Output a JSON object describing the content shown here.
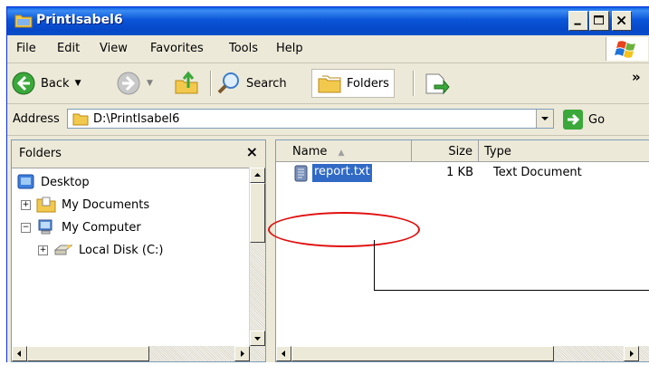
{
  "window": {
    "title": "PrintIsabel6"
  },
  "menubar": {
    "items": [
      "File",
      "Edit",
      "View",
      "Favorites",
      "Tools",
      "Help"
    ]
  },
  "toolbar": {
    "back_label": "Back",
    "search_label": "Search",
    "folders_label": "Folders",
    "overflow": "»"
  },
  "address": {
    "label": "Address",
    "value": "D:\\PrintIsabel6",
    "go_label": "Go"
  },
  "folders_pane": {
    "title": "Folders",
    "close": "×",
    "tree": [
      {
        "label": "Desktop",
        "icon": "desktop-icon"
      },
      {
        "label": "My Documents",
        "icon": "my-documents-icon",
        "expander": "+"
      },
      {
        "label": "My Computer",
        "icon": "my-computer-icon",
        "expander": "−"
      },
      {
        "label": "Local Disk (C:)",
        "icon": "local-disk-icon",
        "expander": "+"
      }
    ]
  },
  "files_pane": {
    "columns": {
      "name": "Name",
      "size": "Size",
      "type": "Type"
    },
    "rows": [
      {
        "name": "report.txt",
        "size": "1 KB",
        "type": "Text Document",
        "selected": true
      }
    ]
  },
  "colors": {
    "title_blue": "#0a55d8",
    "selection": "#316ac5",
    "callout_red": "#e01010"
  }
}
